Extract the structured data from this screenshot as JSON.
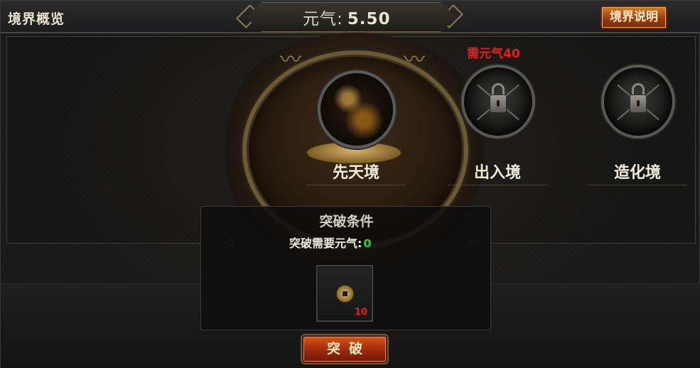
{
  "header": {
    "title": "境界概览",
    "qi_label": "元气:",
    "qi_value": "5.50",
    "desc_button": "境界说明"
  },
  "realms": [
    {
      "name": "先天境",
      "locked": false
    },
    {
      "name": "出入境",
      "locked": true,
      "requirement": "需元气40"
    },
    {
      "name": "造化境",
      "locked": true
    }
  ],
  "conditions": {
    "title": "突破条件",
    "qi_needed_label": "突破需要元气:",
    "qi_needed_value": "0",
    "item": {
      "icon": "copper-coin-icon",
      "count": "10"
    }
  },
  "actions": {
    "break_button": "突破"
  },
  "colors": {
    "requirement_red": "#e81e1e",
    "value_green": "#2ecc2e",
    "button_orange": "#d8561c"
  }
}
